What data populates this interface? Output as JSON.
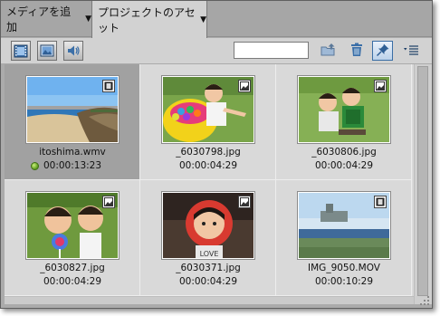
{
  "tabs": {
    "add_media": "メディアを追加",
    "project_assets": "プロジェクトのアセット",
    "dropdown_arrow": "▼"
  },
  "toolbar": {
    "search_value": "",
    "icons": [
      "film-filter-icon",
      "image-filter-icon",
      "audio-filter-icon",
      "new-folder-icon",
      "trash-icon",
      "pin-icon",
      "panel-menu-icon"
    ]
  },
  "assets": [
    {
      "name": "itoshima.wmv",
      "duration": "00:00:13:23",
      "type": "video",
      "selected": true,
      "in_use": true
    },
    {
      "name": "_6030798.jpg",
      "duration": "00:00:04:29",
      "type": "image",
      "selected": false,
      "in_use": false
    },
    {
      "name": "_6030806.jpg",
      "duration": "00:00:04:29",
      "type": "image",
      "selected": false,
      "in_use": false
    },
    {
      "name": "_6030827.jpg",
      "duration": "00:00:04:29",
      "type": "image",
      "selected": false,
      "in_use": false
    },
    {
      "name": "_6030371.jpg",
      "duration": "00:00:04:29",
      "type": "image",
      "selected": false,
      "in_use": false
    },
    {
      "name": "IMG_9050.MOV",
      "duration": "00:00:10:29",
      "type": "video",
      "selected": false,
      "in_use": false
    }
  ],
  "colors": {
    "panel_bg": "#d9d9d9",
    "selected_cell": "#a1a1a1",
    "tab_bar": "#a6a6a6",
    "pin_accent": "#3a6ea5",
    "in_use_dot": "#5d9a1e"
  }
}
